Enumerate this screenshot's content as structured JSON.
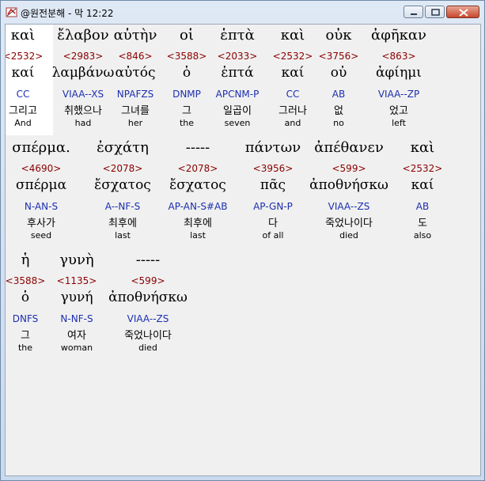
{
  "window": {
    "title": "@원전분해 - 막 12:22",
    "icon": "app-book-icon"
  },
  "rows": [
    {
      "words": [
        {
          "word": "καὶ",
          "strong": "<2532>",
          "lemma": "καί",
          "morph": "CC",
          "korean": "그리고",
          "english": "And"
        },
        {
          "word": "ἔλαβον",
          "strong": "<2983>",
          "lemma": "λαμβάνω",
          "morph": "VIAA--XS",
          "korean": "취했으나",
          "english": "had"
        },
        {
          "word": "αὐτὴν",
          "strong": "<846>",
          "lemma": "αὐτός",
          "morph": "NPAFZS",
          "korean": "그녀를",
          "english": "her"
        },
        {
          "word": "οἱ",
          "strong": "<3588>",
          "lemma": "ὁ",
          "morph": "DNMP",
          "korean": "그",
          "english": "the"
        },
        {
          "word": "ἑπτὰ",
          "strong": "<2033>",
          "lemma": "ἑπτά",
          "morph": "APCNM-P",
          "korean": "일곱이",
          "english": "seven"
        },
        {
          "word": "καὶ",
          "strong": "<2532>",
          "lemma": "καί",
          "morph": "CC",
          "korean": "그러나",
          "english": "and"
        },
        {
          "word": "οὐκ",
          "strong": "<3756>",
          "lemma": "οὐ",
          "morph": "AB",
          "korean": "없",
          "english": "no"
        },
        {
          "word": "ἀφῆκαν",
          "strong": "<863>",
          "lemma": "ἀφίημι",
          "morph": "VIAA--ZP",
          "korean": "었고",
          "english": "left"
        }
      ]
    },
    {
      "words": [
        {
          "word": "σπέρμα.",
          "strong": "<4690>",
          "lemma": "σπέρμα",
          "morph": "N-AN-S",
          "korean": "후사가",
          "english": "seed"
        },
        {
          "word": "ἐσχάτη",
          "strong": "<2078>",
          "lemma": "ἔσχατος",
          "morph": "A--NF-S",
          "korean": "최후에",
          "english": "last"
        },
        {
          "word": "-----",
          "strong": "<2078>",
          "lemma": "ἔσχατος",
          "morph": "AP-AN-S#AB",
          "korean": "최후에",
          "english": "last"
        },
        {
          "word": "πάντων",
          "strong": "<3956>",
          "lemma": "πᾶς",
          "morph": "AP-GN-P",
          "korean": "다",
          "english": "of all"
        },
        {
          "word": "ἀπέθανεν",
          "strong": "<599>",
          "lemma": "ἀποθνήσκω",
          "morph": "VIAA--ZS",
          "korean": "죽었나이다",
          "english": "died"
        },
        {
          "word": "καὶ",
          "strong": "<2532>",
          "lemma": "καί",
          "morph": "AB",
          "korean": "도",
          "english": "also"
        }
      ]
    },
    {
      "words": [
        {
          "word": "ἡ",
          "strong": "<3588>",
          "lemma": "ὁ",
          "morph": "DNFS",
          "korean": "그",
          "english": "the"
        },
        {
          "word": "γυνὴ",
          "strong": "<1135>",
          "lemma": "γυνή",
          "morph": "N-NF-S",
          "korean": "여자",
          "english": "woman"
        },
        {
          "word": "-----",
          "strong": "<599>",
          "lemma": "ἀποθνήσκω",
          "morph": "VIAA--ZS",
          "korean": "죽었나이다",
          "english": "died"
        }
      ]
    }
  ]
}
